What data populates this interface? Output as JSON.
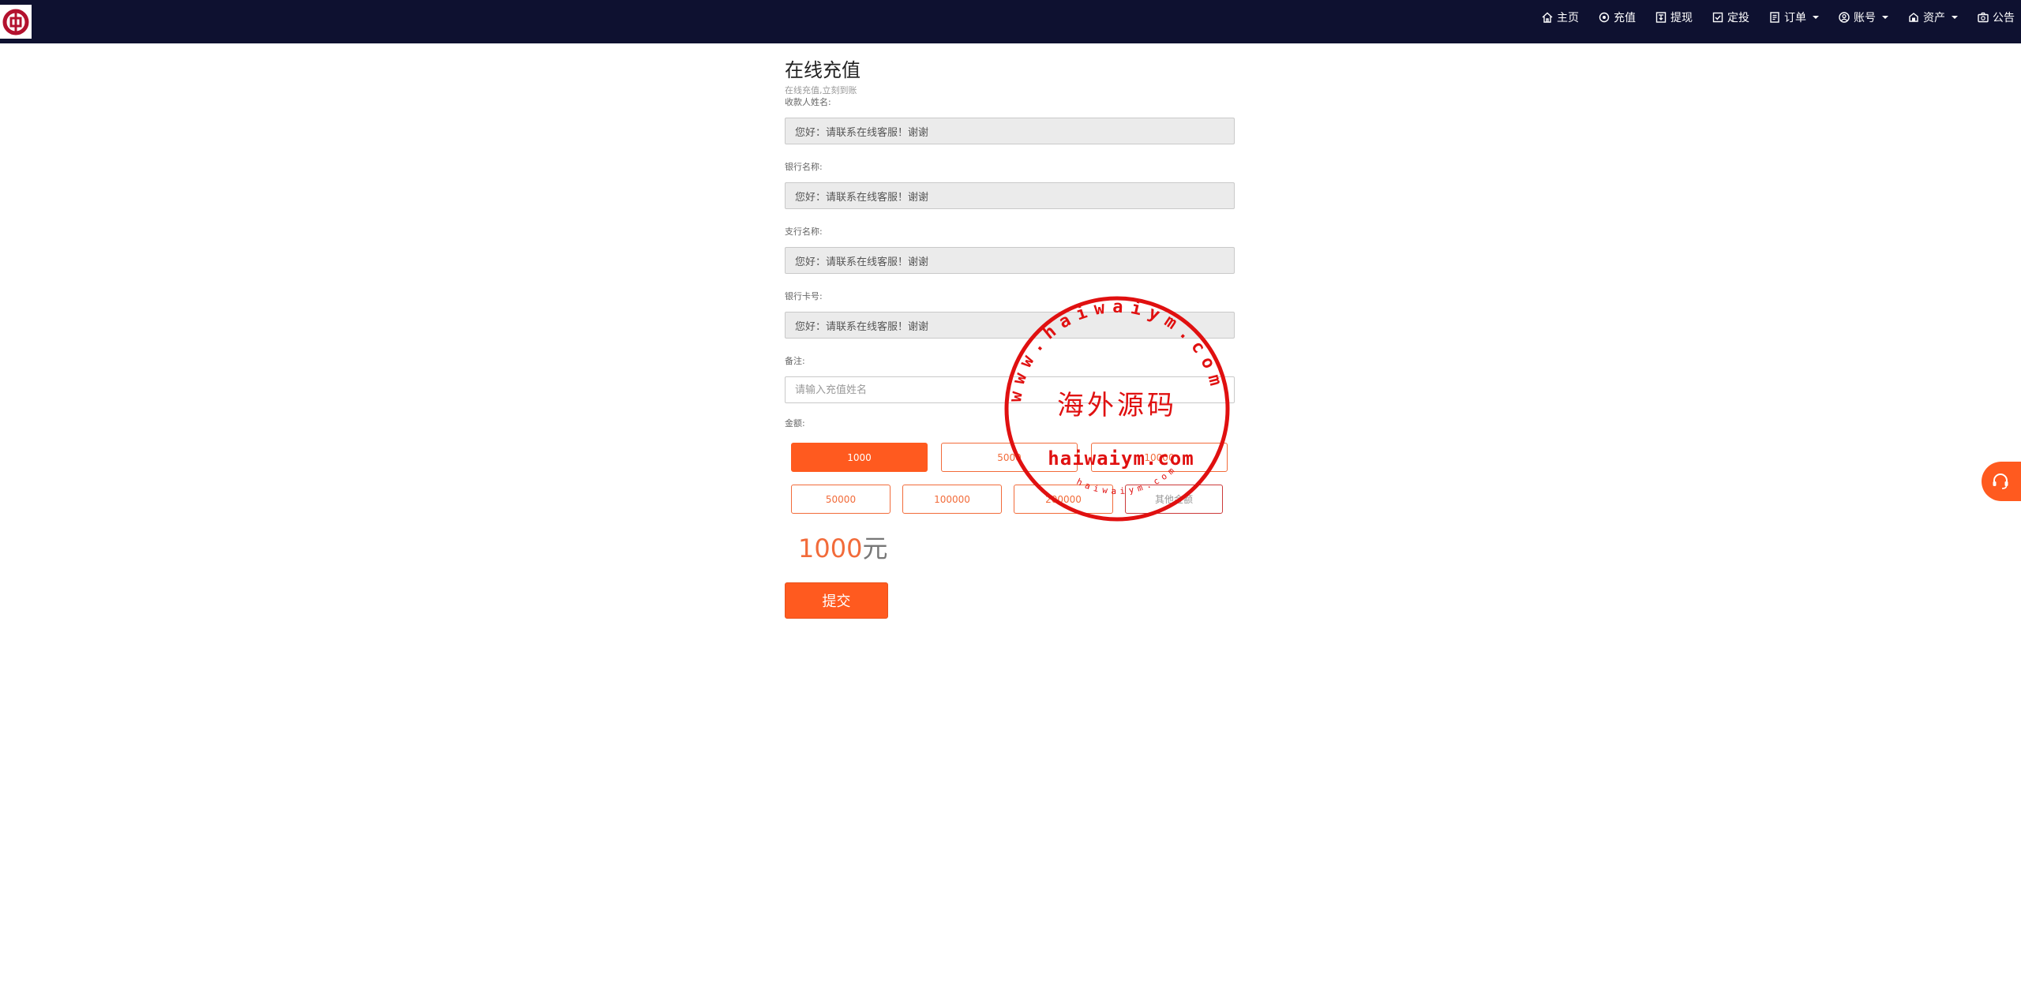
{
  "nav": {
    "items": [
      {
        "label": "主页",
        "icon": "home-icon",
        "dropdown": false
      },
      {
        "label": "充值",
        "icon": "recharge-icon",
        "dropdown": false
      },
      {
        "label": "提现",
        "icon": "withdraw-icon",
        "dropdown": false
      },
      {
        "label": "定投",
        "icon": "checkbox-icon",
        "dropdown": false
      },
      {
        "label": "订单",
        "icon": "order-icon",
        "dropdown": true
      },
      {
        "label": "账号",
        "icon": "account-icon",
        "dropdown": true
      },
      {
        "label": "资产",
        "icon": "assets-icon",
        "dropdown": true
      },
      {
        "label": "公告",
        "icon": "notice-icon",
        "dropdown": false
      }
    ]
  },
  "page": {
    "title": "在线充值",
    "subtitle": "在线充值,立刻到账"
  },
  "form": {
    "payee_name": {
      "label": "收款人姓名:",
      "value": "您好：请联系在线客服！谢谢"
    },
    "bank_name": {
      "label": "银行名称:",
      "value": "您好：请联系在线客服！谢谢"
    },
    "branch_name": {
      "label": "支行名称:",
      "value": "您好：请联系在线客服！谢谢"
    },
    "card_number": {
      "label": "银行卡号:",
      "value": "您好：请联系在线客服！谢谢"
    },
    "remark": {
      "label": "备注:",
      "placeholder": "请输入充值姓名",
      "value": ""
    },
    "amount": {
      "label": "金额:",
      "row1": [
        "1000",
        "5000",
        "10000"
      ],
      "row2": [
        "50000",
        "100000",
        "200000"
      ],
      "custom_placeholder": "其他金额",
      "selected": "1000"
    },
    "total": {
      "value": "1000",
      "unit": "元"
    },
    "submit_label": "提交"
  },
  "watermark": {
    "center_text": "海外源码",
    "domain_text": "haiwaiym.com",
    "ring_text": "www.haiwaiym.com",
    "small_ring_text": "haiwaiym.com",
    "color": "#e01010"
  },
  "colors": {
    "nav_bg": "#0e1130",
    "accent": "#ff5a1f",
    "input_bg": "#ebebeb"
  }
}
